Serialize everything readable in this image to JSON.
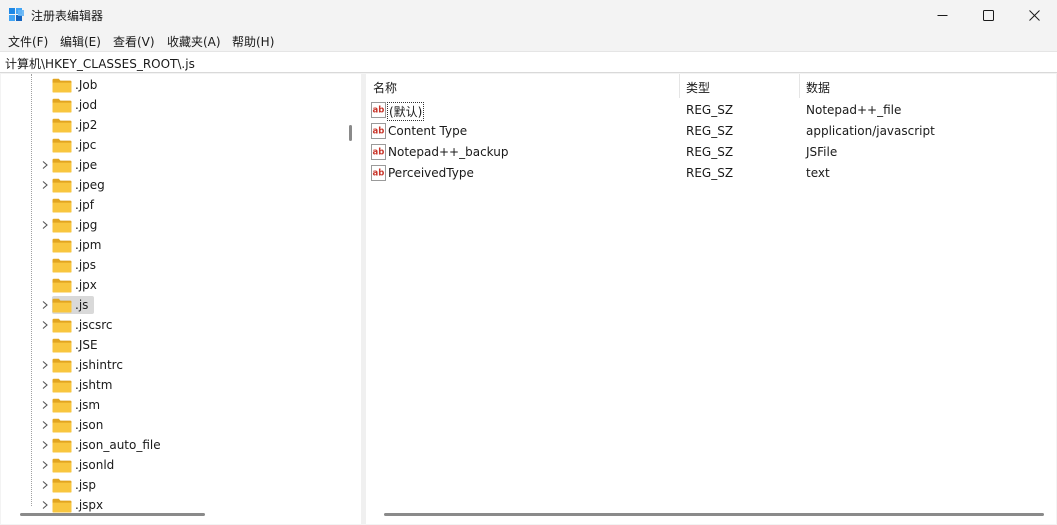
{
  "window": {
    "title": "注册表编辑器"
  },
  "menu": {
    "items": [
      "文件(F)",
      "编辑(E)",
      "查看(V)",
      "收藏夹(A)",
      "帮助(H)"
    ]
  },
  "address": {
    "path": "计算机\\HKEY_CLASSES_ROOT\\.js"
  },
  "tree": {
    "items": [
      {
        "label": ".Job",
        "expandable": false,
        "selected": false
      },
      {
        "label": ".jod",
        "expandable": false,
        "selected": false
      },
      {
        "label": ".jp2",
        "expandable": false,
        "selected": false
      },
      {
        "label": ".jpc",
        "expandable": false,
        "selected": false
      },
      {
        "label": ".jpe",
        "expandable": true,
        "selected": false
      },
      {
        "label": ".jpeg",
        "expandable": true,
        "selected": false
      },
      {
        "label": ".jpf",
        "expandable": false,
        "selected": false
      },
      {
        "label": ".jpg",
        "expandable": true,
        "selected": false
      },
      {
        "label": ".jpm",
        "expandable": false,
        "selected": false
      },
      {
        "label": ".jps",
        "expandable": false,
        "selected": false
      },
      {
        "label": ".jpx",
        "expandable": false,
        "selected": false
      },
      {
        "label": ".js",
        "expandable": true,
        "selected": true
      },
      {
        "label": ".jscsrc",
        "expandable": true,
        "selected": false
      },
      {
        "label": ".JSE",
        "expandable": false,
        "selected": false
      },
      {
        "label": ".jshintrc",
        "expandable": true,
        "selected": false
      },
      {
        "label": ".jshtm",
        "expandable": true,
        "selected": false
      },
      {
        "label": ".jsm",
        "expandable": true,
        "selected": false
      },
      {
        "label": ".json",
        "expandable": true,
        "selected": false
      },
      {
        "label": ".json_auto_file",
        "expandable": true,
        "selected": false
      },
      {
        "label": ".jsonld",
        "expandable": true,
        "selected": false
      },
      {
        "label": ".jsp",
        "expandable": true,
        "selected": false
      },
      {
        "label": ".jspx",
        "expandable": true,
        "selected": false
      }
    ]
  },
  "values": {
    "columns": {
      "name": "名称",
      "type": "类型",
      "data": "数据"
    },
    "rows": [
      {
        "name": "(默认)",
        "type": "REG_SZ",
        "data": "Notepad++_file",
        "focused": true
      },
      {
        "name": "Content Type",
        "type": "REG_SZ",
        "data": "application/javascript",
        "focused": false
      },
      {
        "name": "Notepad++_backup",
        "type": "REG_SZ",
        "data": "JSFile",
        "focused": false
      },
      {
        "name": "PerceivedType",
        "type": "REG_SZ",
        "data": "text",
        "focused": false
      }
    ]
  },
  "colors": {
    "folder": "#f8c63f",
    "folder_dark": "#e2a520",
    "value_icon_red": "#c8362b",
    "selection": "#d9d9d9"
  }
}
